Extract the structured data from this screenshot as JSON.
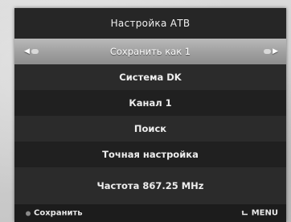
{
  "menu": {
    "title": "Настройка АТВ",
    "selected_item": {
      "label": "Сохранить как 1"
    },
    "items": [
      {
        "label": "Система DK"
      },
      {
        "label": "Канал 1"
      },
      {
        "label": "Поиск"
      },
      {
        "label": "Точная настройка"
      },
      {
        "label": "Частота 867.25 MHz"
      }
    ]
  },
  "footer": {
    "save_label": "Сохранить",
    "menu_label": "MENU"
  },
  "icons": {
    "left_arrow": "arrow-left-icon",
    "right_arrow": "arrow-right-icon",
    "save_key": "button-dot-icon",
    "menu_key": "return-arrow-icon"
  }
}
